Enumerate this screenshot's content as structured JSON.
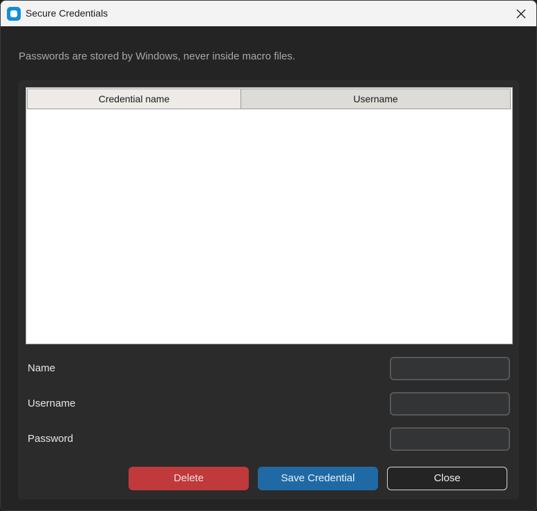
{
  "window": {
    "title": "Secure Credentials",
    "icon": "app-icon",
    "close_icon": "close-icon"
  },
  "subtitle": "Passwords are stored by Windows, never inside macro files.",
  "table": {
    "columns": [
      "Credential name",
      "Username"
    ],
    "rows": []
  },
  "form": {
    "name_label": "Name",
    "name_value": "",
    "username_label": "Username",
    "username_value": "",
    "password_label": "Password",
    "password_value": ""
  },
  "buttons": {
    "delete_label": "Delete",
    "save_label": "Save Credential",
    "close_label": "Close"
  },
  "colors": {
    "accent": "#1f6aa5",
    "danger": "#c0393b",
    "background": "#242424",
    "panel": "#2b2b2b"
  }
}
